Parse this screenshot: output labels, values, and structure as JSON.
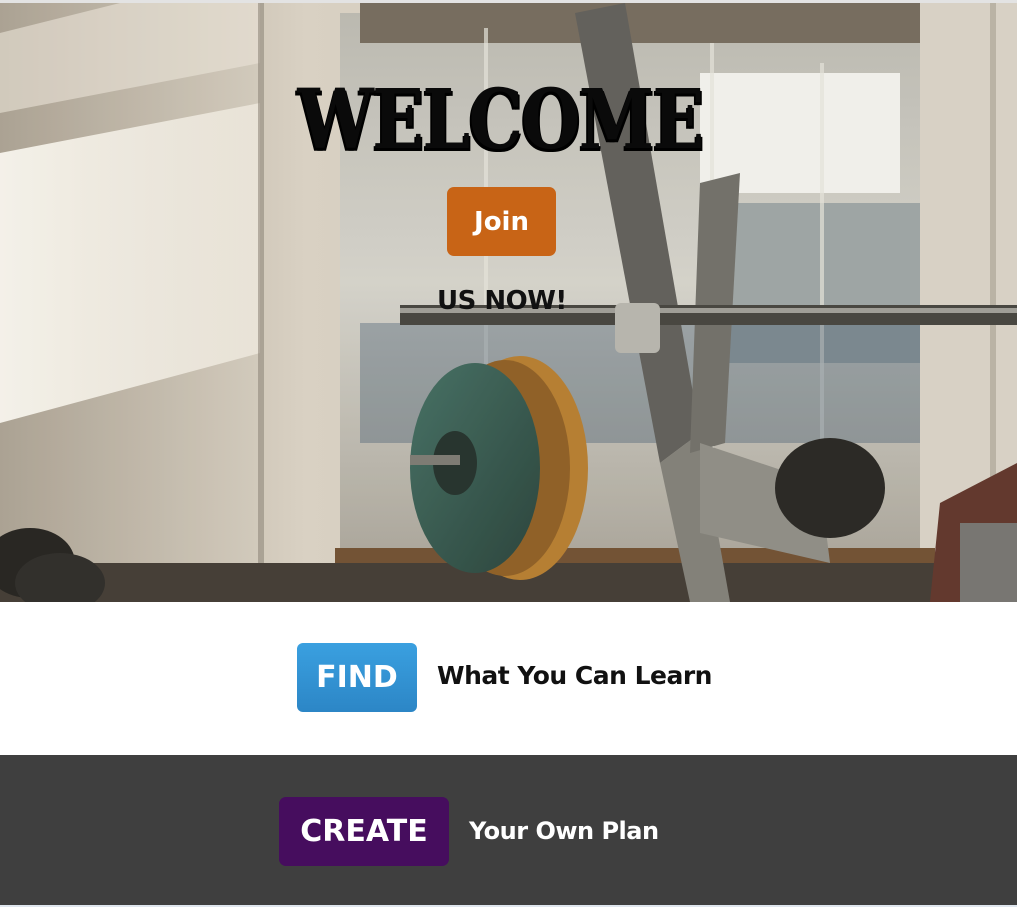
{
  "hero": {
    "background_image": "gym-barbell-rack-photo",
    "title": "WELCOME",
    "join_button_label": "Join",
    "join_button_color": "#c86416",
    "subtitle": "US NOW!"
  },
  "find": {
    "button_label": "FIND",
    "button_color": "#3399dd",
    "text": "What You Can Learn"
  },
  "create": {
    "button_label": "CREATE",
    "button_color": "#460d5e",
    "text": "Your Own Plan",
    "section_background": "#3f3f3f"
  }
}
